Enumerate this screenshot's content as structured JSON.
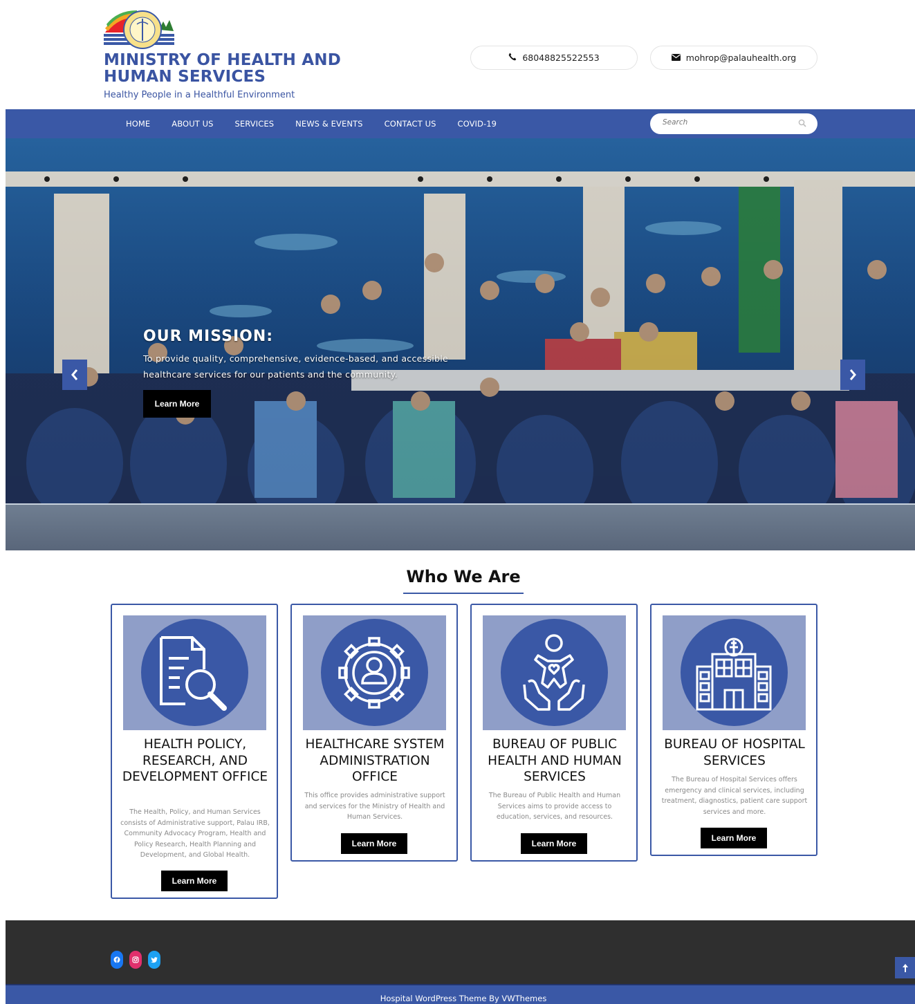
{
  "header": {
    "site_title": "MINISTRY OF HEALTH AND HUMAN SERVICES",
    "tagline": "Healthy People in a Healthful Environment",
    "phone": "68048825522553",
    "email": "mohrop@palauhealth.org"
  },
  "nav": {
    "items": [
      {
        "label": "HOME"
      },
      {
        "label": "ABOUT US"
      },
      {
        "label": "SERVICES"
      },
      {
        "label": "NEWS & EVENTS"
      },
      {
        "label": "CONTACT US"
      },
      {
        "label": "COVID-19"
      }
    ],
    "search_placeholder": "Search"
  },
  "hero": {
    "title": "OUR MISSION:",
    "text": "To provide quality, comprehensive, evidence-based, and accessible healthcare services for our patients and the community.",
    "button": "Learn More"
  },
  "who_we_are": {
    "title": "Who We Are",
    "cards": [
      {
        "icon": "document-search-icon",
        "title": "HEALTH POLICY, RESEARCH, AND DEVELOPMENT OFFICE",
        "description": "The Health, Policy, and Human Services consists of Administrative support, Palau IRB, Community Advocacy Program, Health and Policy Research, Health Planning and Development, and Global Health.",
        "button": "Learn More"
      },
      {
        "icon": "person-gear-icon",
        "title": "HEALTHCARE SYSTEM ADMINISTRATION OFFICE",
        "description": "This office provides administrative support and services for the Ministry of Health and Human Services.",
        "button": "Learn More"
      },
      {
        "icon": "child-care-hands-icon",
        "title": "BUREAU OF PUBLIC HEALTH AND HUMAN SERVICES",
        "description": "The Bureau of Public Health and Human Services aims to provide access to education, services, and resources.",
        "button": "Learn More"
      },
      {
        "icon": "hospital-building-icon",
        "title": "BUREAU OF HOSPITAL SERVICES",
        "description": "The Bureau of Hospital Services offers emergency and clinical services, including treatment, diagnostics, patient care support services and more.",
        "button": "Learn More"
      }
    ]
  },
  "footer": {
    "social": [
      "facebook-icon",
      "instagram-icon",
      "twitter-icon"
    ],
    "copyright": "Hospital WordPress Theme By VWThemes"
  },
  "colors": {
    "brand_blue": "#3a58a6",
    "card_image_bg": "#8f9ec8",
    "footer_dark": "#2f2f2f"
  }
}
